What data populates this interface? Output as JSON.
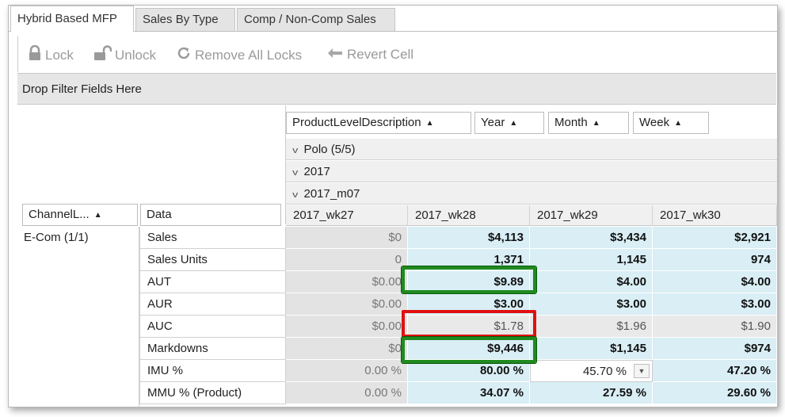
{
  "tabs": [
    {
      "label": "Hybrid Based MFP"
    },
    {
      "label": "Sales By Type"
    },
    {
      "label": "Comp / Non-Comp Sales"
    }
  ],
  "toolbar": {
    "lock": "Lock",
    "unlock": "Unlock",
    "remove_all_locks": "Remove All Locks",
    "revert_cell": "Revert Cell"
  },
  "filter_area": "Drop Filter Fields Here",
  "column_fields": [
    "ProductLevelDescription",
    "Year",
    "Month",
    "Week"
  ],
  "row_fields": [
    "ChannelL...",
    "Data"
  ],
  "expanders": [
    "Polo (5/5)",
    "2017",
    "2017_m07"
  ],
  "weeks": [
    "2017_wk27",
    "2017_wk28",
    "2017_wk29",
    "2017_wk30"
  ],
  "channel": "E-Com (1/1)",
  "rows": [
    {
      "label": "Sales",
      "values": [
        "$0",
        "$4,113",
        "$3,434",
        "$2,921"
      ]
    },
    {
      "label": "Sales Units",
      "values": [
        "0",
        "1,371",
        "1,145",
        "974"
      ]
    },
    {
      "label": "AUT",
      "values": [
        "$0.00",
        "$9.89",
        "$4.00",
        "$4.00"
      ]
    },
    {
      "label": "AUR",
      "values": [
        "$0.00",
        "$3.00",
        "$3.00",
        "$3.00"
      ]
    },
    {
      "label": "AUC",
      "values": [
        "$0.00",
        "$1.78",
        "$1.96",
        "$1.90"
      ]
    },
    {
      "label": "Markdowns",
      "values": [
        "$0",
        "$9,446",
        "$1,145",
        "$974"
      ]
    },
    {
      "label": "IMU %",
      "values": [
        "0.00 %",
        "80.00 %",
        "45.70 %",
        "47.20 %"
      ]
    },
    {
      "label": "MMU % (Product)",
      "values": [
        "0.00 %",
        "34.07 %",
        "27.59 %",
        "29.60 %"
      ]
    }
  ],
  "colors": {
    "highlight_green": "#1f8a1f",
    "highlight_red": "#e01010",
    "cell_blue": "#d9eef5"
  }
}
